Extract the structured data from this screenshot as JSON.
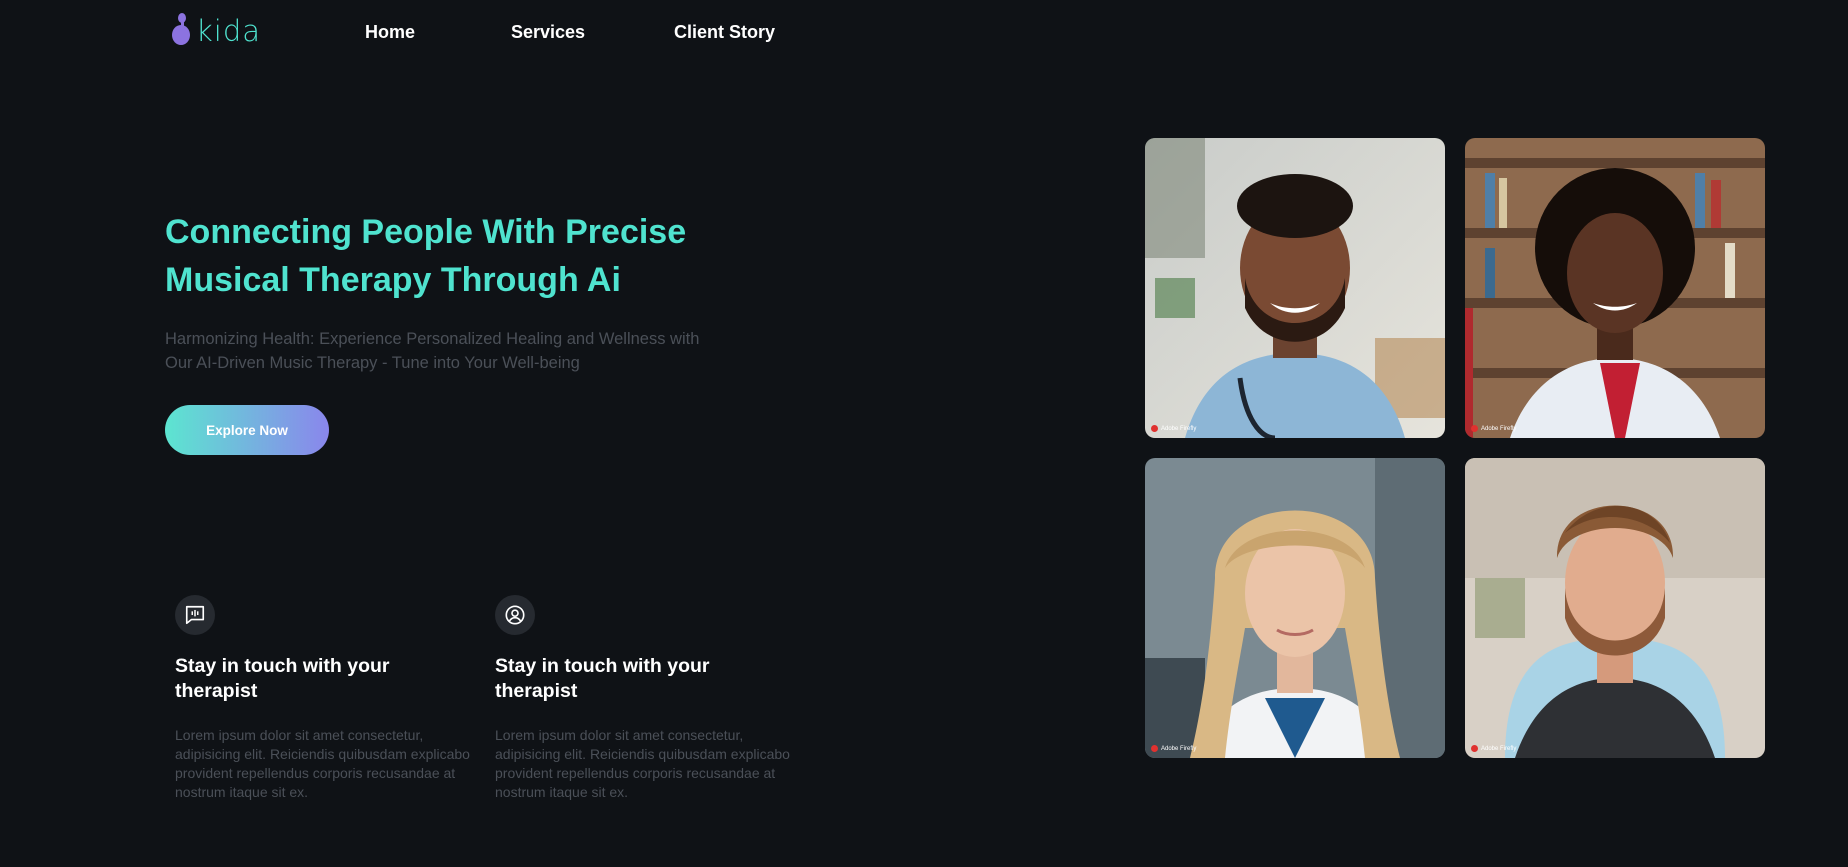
{
  "nav": {
    "logo_text": "kida",
    "links": [
      {
        "label": "Home"
      },
      {
        "label": "Services"
      },
      {
        "label": "Client Story"
      }
    ]
  },
  "hero": {
    "title": "Connecting People With Precise Musical Therapy Through Ai",
    "subtitle": "Harmonizing Health: Experience Personalized Healing and Wellness with Our AI-Driven Music Therapy - Tune into Your Well-being",
    "cta_label": "Explore Now"
  },
  "features": [
    {
      "icon": "chat-audio-icon",
      "title": "Stay in touch with your therapist",
      "text": "Lorem ipsum dolor sit amet consectetur, adipisicing elit. Reiciendis quibusdam explicabo provident repellendus corporis recusandae at nostrum itaque sit ex."
    },
    {
      "icon": "user-circle-icon",
      "title": "Stay in touch with your therapist",
      "text": "Lorem ipsum dolor sit amet consectetur, adipisicing elit. Reiciendis quibusdam explicabo provident repellendus corporis recusandae at nostrum itaque sit ex."
    }
  ],
  "gallery": [
    {
      "subject": "smiling male doctor in blue scrubs with stethoscope"
    },
    {
      "subject": "smiling female doctor in white coat with stethoscope"
    },
    {
      "subject": "blonde woman in white coat"
    },
    {
      "subject": "bearded man in dark t-shirt"
    }
  ],
  "colors": {
    "background": "#0f1216",
    "accent_teal": "#4fe3cf",
    "accent_purple": "#8a86ec",
    "muted_text": "#4b5058"
  }
}
